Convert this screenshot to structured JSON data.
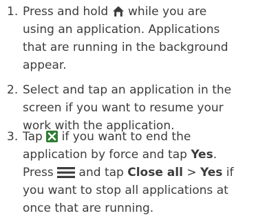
{
  "steps": [
    {
      "number": "1.",
      "line1_before_icon": "Press and hold ",
      "line1_icon": "home-icon",
      "line1_after_icon": " while you are",
      "line2": "using an application. Applications",
      "line3": "that are running in the background",
      "line4": "appear."
    },
    {
      "number": "2.",
      "line1": "Select and tap an application in the",
      "line2": "screen if you want to resume your",
      "line3": "work with the application."
    },
    {
      "number": "3.",
      "line1_before_icon": "Tap ",
      "line1_icon": "close-x-icon",
      "line1_after_icon": " if you want to end the",
      "line2_before_bold": "application by force and tap ",
      "line2_bold": "Yes",
      "line2_after_bold": ".",
      "line3_before_icon": "Press ",
      "line3_icon": "menu-icon",
      "line3_middle": " and tap ",
      "line3_bold1": "Close all",
      "line3_sep": " > ",
      "line3_bold2": "Yes",
      "line3_after": " if",
      "line4": "you want to stop all applications at",
      "line5": "once that are running."
    }
  ],
  "colors": {
    "text": "#3c3c3c",
    "close_icon_bg": "#2e7d32",
    "close_icon_fg": "#ffffff"
  }
}
